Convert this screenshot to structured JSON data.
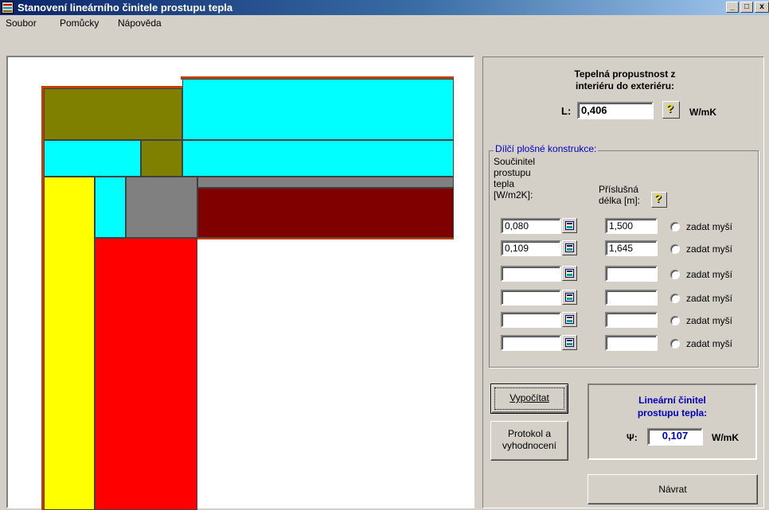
{
  "window": {
    "title": "Stanovení lineárního činitele prostupu tepla",
    "minimize_glyph": "_",
    "maximize_glyph": "□",
    "close_glyph": "x",
    "icon": "app-icon"
  },
  "menu": [
    "Soubor",
    "Pomůcky",
    "Nápověda"
  ],
  "colors": {
    "concrete_olive": "#808000",
    "insulation_cyan": "#00ffff",
    "yellow": "#ffff00",
    "red": "#ff0000",
    "gray": "#808080",
    "dark_red": "#800000",
    "outline": "#c04000"
  },
  "thermal": {
    "title_line1": "Tepelná propustnost z",
    "title_line2": "interiéru do exteriéru:",
    "l_label": "L:",
    "l_value": "0,406",
    "unit": "W/mK"
  },
  "group": {
    "legend": "Dílčí plošné konstrukce:",
    "u_header": [
      "Součinitel",
      "prostupu",
      "tepla",
      "[W/m2K]:"
    ],
    "len_header": [
      "Příslušná",
      "délka [m]:"
    ],
    "rows": [
      {
        "u": "0,080",
        "length": "1,500",
        "radio": "zadat myší"
      },
      {
        "u": "0,109",
        "length": "1,645",
        "radio": "zadat myší"
      },
      {
        "u": "",
        "length": "",
        "radio": "zadat myší"
      },
      {
        "u": "",
        "length": "",
        "radio": "zadat myší"
      },
      {
        "u": "",
        "length": "",
        "radio": "zadat myší"
      },
      {
        "u": "",
        "length": "",
        "radio": "zadat myší"
      }
    ]
  },
  "buttons": {
    "calculate": "Vypočítat",
    "protocol_line1": "Protokol a",
    "protocol_line2": "vyhodnocení",
    "back": "Návrat"
  },
  "result": {
    "title_line1": "Lineární činitel",
    "title_line2": "prostupu tepla:",
    "psi_label": "Ψ:",
    "value": "0,107",
    "unit": "W/mK"
  }
}
